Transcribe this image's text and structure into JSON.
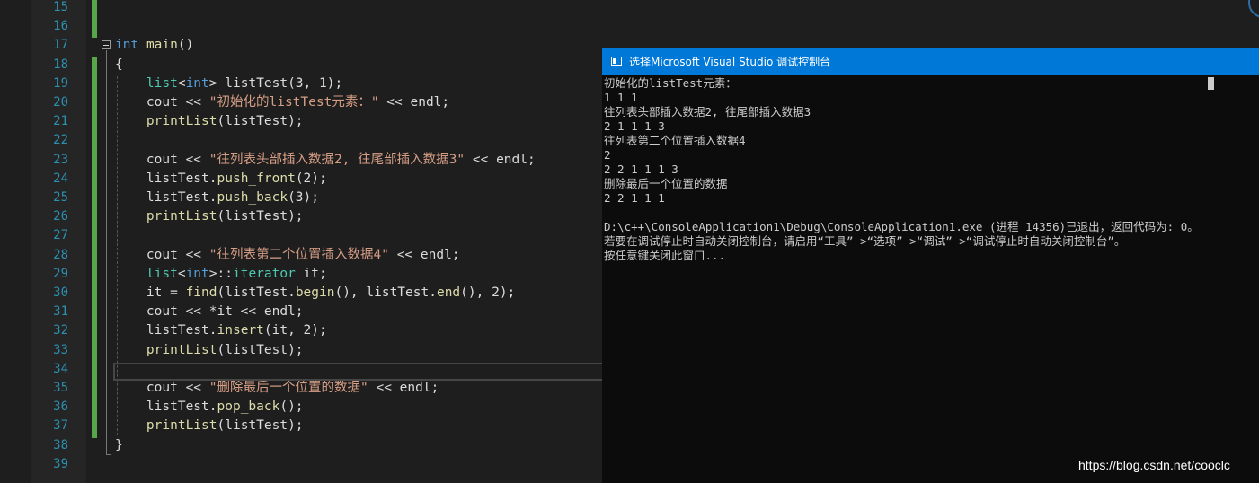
{
  "editor": {
    "lines": [
      {
        "n": "15",
        "html": ""
      },
      {
        "n": "16",
        "html": ""
      },
      {
        "n": "17",
        "html": "<span class='kw'>int</span> <span class='fn'>main</span>()"
      },
      {
        "n": "18",
        "html": "{"
      },
      {
        "n": "19",
        "html": "    <span class='ty'>list</span>&lt;<span class='kw'>int</span>&gt; listTest(3, 1);"
      },
      {
        "n": "20",
        "html": "    cout &lt;&lt; <span class='str'>\"初始化的listTest元素：\"</span> &lt;&lt; endl;"
      },
      {
        "n": "21",
        "html": "    <span class='fn'>printList</span>(listTest);"
      },
      {
        "n": "22",
        "html": ""
      },
      {
        "n": "23",
        "html": "    cout &lt;&lt; <span class='str'>\"往列表头部插入数据2, 往尾部插入数据3\"</span> &lt;&lt; endl;"
      },
      {
        "n": "24",
        "html": "    listTest.<span class='fn'>push_front</span>(2);"
      },
      {
        "n": "25",
        "html": "    listTest.<span class='fn'>push_back</span>(3);"
      },
      {
        "n": "26",
        "html": "    <span class='fn'>printList</span>(listTest);"
      },
      {
        "n": "27",
        "html": ""
      },
      {
        "n": "28",
        "html": "    cout &lt;&lt; <span class='str'>\"往列表第二个位置插入数据4\"</span> &lt;&lt; endl;"
      },
      {
        "n": "29",
        "html": "    <span class='ty'>list</span>&lt;<span class='kw'>int</span>&gt;::<span class='ty'>iterator</span> it;"
      },
      {
        "n": "30",
        "html": "    it = <span class='fn'>find</span>(listTest.<span class='fn'>begin</span>(), listTest.<span class='fn'>end</span>(), 2);"
      },
      {
        "n": "31",
        "html": "    cout &lt;&lt; *it &lt;&lt; endl;"
      },
      {
        "n": "32",
        "html": "    listTest.<span class='fn'>insert</span>(it, 2);"
      },
      {
        "n": "33",
        "html": "    <span class='fn'>printList</span>(listTest);"
      },
      {
        "n": "34",
        "html": ""
      },
      {
        "n": "35",
        "html": "    cout &lt;&lt; <span class='str'>\"删除最后一个位置的数据\"</span> &lt;&lt; endl;"
      },
      {
        "n": "36",
        "html": "    listTest.<span class='fn'>pop_back</span>();"
      },
      {
        "n": "37",
        "html": "    <span class='fn'>printList</span>(listTest);"
      },
      {
        "n": "38",
        "html": "}"
      },
      {
        "n": "39",
        "html": ""
      }
    ]
  },
  "console": {
    "title": "选择Microsoft Visual Studio 调试控制台",
    "lines": [
      "初始化的listTest元素：",
      "1 1 1",
      "往列表头部插入数据2, 往尾部插入数据3",
      "2 1 1 1 3",
      "往列表第二个位置插入数据4",
      "2",
      "2 2 1 1 1 3",
      "删除最后一个位置的数据",
      "2 2 1 1 1",
      "",
      "D:\\c++\\ConsoleApplication1\\Debug\\ConsoleApplication1.exe (进程 14356)已退出，返回代码为: 0。",
      "若要在调试停止时自动关闭控制台，请启用“工具”->“选项”->“调试”->“调试停止时自动关闭控制台”。",
      "按任意键关闭此窗口..."
    ]
  },
  "watermark": "https://blog.csdn.net/cooclc",
  "colors": {
    "keyword": "#569cd6",
    "string": "#d69d85",
    "function": "#dcdcaa",
    "type": "#4ec9b0",
    "line_number": "#2b91af",
    "change_bar": "#57a64a",
    "console_title": "#0078d7"
  }
}
